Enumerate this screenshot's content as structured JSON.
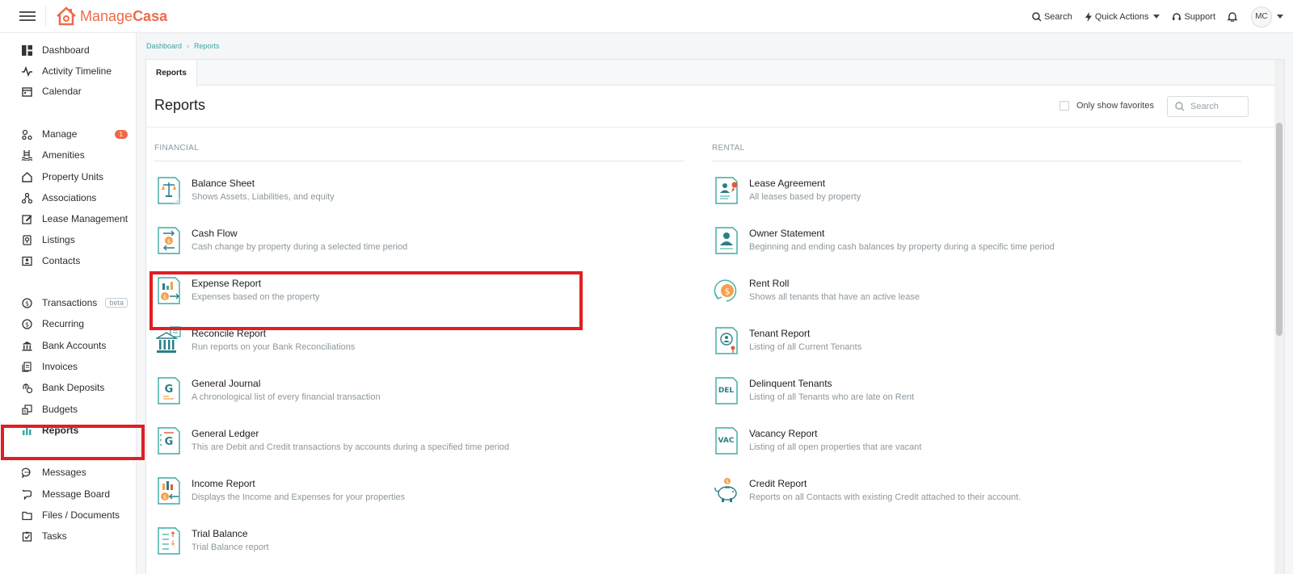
{
  "brand": {
    "name_part1": "Manage",
    "name_part2": "Casa",
    "color": "#ef6a4a"
  },
  "topbar": {
    "search_label": "Search",
    "quick_actions_label": "Quick Actions",
    "support_label": "Support",
    "avatar_initials": "MC"
  },
  "sidebar": {
    "items": [
      {
        "label": "Dashboard",
        "icon": "dashboard-icon"
      },
      {
        "label": "Activity Timeline",
        "icon": "activity-icon"
      },
      {
        "label": "Calendar",
        "icon": "calendar-icon"
      },
      {
        "label": "Manage",
        "icon": "manage-icon",
        "badge": "1"
      },
      {
        "label": "Amenities",
        "icon": "pool-icon"
      },
      {
        "label": "Property Units",
        "icon": "home-icon"
      },
      {
        "label": "Associations",
        "icon": "network-icon"
      },
      {
        "label": "Lease Management",
        "icon": "edit-icon"
      },
      {
        "label": "Listings",
        "icon": "listing-icon"
      },
      {
        "label": "Contacts",
        "icon": "contact-icon"
      },
      {
        "label": "Transactions",
        "icon": "dollar-icon",
        "tag": "beta"
      },
      {
        "label": "Recurring",
        "icon": "recurring-icon"
      },
      {
        "label": "Bank Accounts",
        "icon": "bank-icon"
      },
      {
        "label": "Invoices",
        "icon": "invoice-icon"
      },
      {
        "label": "Bank Deposits",
        "icon": "deposit-icon"
      },
      {
        "label": "Budgets",
        "icon": "budget-icon"
      },
      {
        "label": "Reports",
        "icon": "bar-chart-icon",
        "active": true
      },
      {
        "label": "Messages",
        "icon": "message-icon"
      },
      {
        "label": "Message Board",
        "icon": "board-icon"
      },
      {
        "label": "Files / Documents",
        "icon": "folder-icon"
      },
      {
        "label": "Tasks",
        "icon": "task-icon"
      }
    ]
  },
  "breadcrumb": {
    "home": "Dashboard",
    "current": "Reports"
  },
  "tabs": [
    {
      "label": "Reports"
    }
  ],
  "page": {
    "title": "Reports",
    "favorites_label": "Only show favorites",
    "search_placeholder": "Search"
  },
  "financial": {
    "title": "FINANCIAL",
    "reports": [
      {
        "name": "Balance Sheet",
        "desc": "Shows Assets, Liabilities, and equity",
        "icon": "scale-icon"
      },
      {
        "name": "Cash Flow",
        "desc": "Cash change by property during a selected time period",
        "icon": "cash-flow-icon"
      },
      {
        "name": "Expense Report",
        "desc": "Expenses based on the property",
        "icon": "expense-icon"
      },
      {
        "name": "Reconcile Report",
        "desc": "Run reports on your Bank Reconciliations",
        "icon": "bank-building-icon"
      },
      {
        "name": "General Journal",
        "desc": "A chronological list of every financial transaction",
        "icon": "journal-icon"
      },
      {
        "name": "General Ledger",
        "desc": "This are Debit and Credit transactions by accounts during a specified time period",
        "icon": "ledger-icon"
      },
      {
        "name": "Income Report",
        "desc": "Displays the Income and Expenses for your properties",
        "icon": "income-icon"
      },
      {
        "name": "Trial Balance",
        "desc": "Trial Balance report",
        "icon": "trial-balance-icon"
      }
    ]
  },
  "rental": {
    "title": "RENTAL",
    "reports": [
      {
        "name": "Lease Agreement",
        "desc": "All leases based by property",
        "icon": "lease-icon"
      },
      {
        "name": "Owner Statement",
        "desc": "Beginning and ending cash balances by property during a specific time period",
        "icon": "owner-icon"
      },
      {
        "name": "Rent Roll",
        "desc": "Shows all tenants that have an active lease",
        "icon": "rent-roll-icon"
      },
      {
        "name": "Tenant Report",
        "desc": "Listing of all Current Tenants",
        "icon": "tenant-icon"
      },
      {
        "name": "Delinquent Tenants",
        "desc": "Listing of all Tenants who are late on Rent",
        "icon": "delinquent-icon",
        "badge_text": "DEL"
      },
      {
        "name": "Vacancy Report",
        "desc": "Listing of all open properties that are vacant",
        "icon": "vacancy-icon",
        "badge_text": "VAC"
      },
      {
        "name": "Credit Report",
        "desc": "Reports on all Contacts with existing Credit attached to their account.",
        "icon": "piggy-bank-icon"
      }
    ]
  }
}
